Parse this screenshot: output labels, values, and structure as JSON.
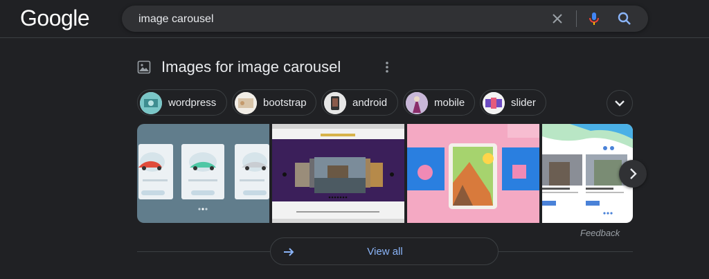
{
  "header": {
    "logo": "Google",
    "search": {
      "value": "image carousel",
      "placeholder": ""
    }
  },
  "section": {
    "title": "Images for image carousel"
  },
  "chips": [
    {
      "label": "wordpress"
    },
    {
      "label": "bootstrap"
    },
    {
      "label": "android"
    },
    {
      "label": "mobile"
    },
    {
      "label": "slider"
    }
  ],
  "feedback": "Feedback",
  "view_all": "View all",
  "colors": {
    "background": "#202124",
    "search_bg": "#303134",
    "link_blue": "#8ab4f8"
  },
  "icons": {
    "clear": "close-icon",
    "mic": "mic-icon",
    "search": "search-icon",
    "images": "images-icon",
    "more": "more-vert-icon",
    "expand": "chevron-down-icon",
    "next": "chevron-right-icon",
    "view_all": "arrow-right-icon"
  }
}
